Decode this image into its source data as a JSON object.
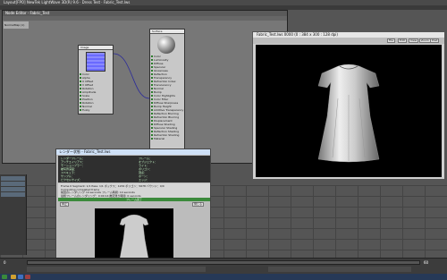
{
  "app": {
    "title": "Layout[FPO] NewTek LightWave 3D(R) 9.6 · Dress Test · Fabric_Test.lws"
  },
  "node_editor": {
    "title": "Node Editor - Fabric_Test",
    "side_label": "NormalMap (1)",
    "image_node": {
      "title": "Image",
      "ports": [
        "Color",
        "Alpha",
        "U Offset",
        "V Offset",
        "Rotation",
        "Amplitude",
        "Scale",
        "Position",
        "Rotation",
        "Normal",
        "Fuzzy"
      ]
    },
    "surface_node": {
      "title": "Surface",
      "ports": [
        "Color",
        "Luminosity",
        "Diffuse",
        "Specular",
        "Glossiness",
        "Reflection",
        "Transparency",
        "Refraction Index",
        "Translucency",
        "Normal",
        "Bump",
        "Color Highlights",
        "Color Filter",
        "Diffuse Sharpness",
        "Bump Height",
        "Additive Transparency",
        "Reflection Blurring",
        "Refraction Blurring",
        "Displacement",
        "Diffuse Shading",
        "Specular Shading",
        "Reflection Shading",
        "Refraction Shading",
        "Material"
      ]
    }
  },
  "render_window": {
    "title": "Fabric_Test.lws  0000  (0  :  384  x  300  :  128  dpi)",
    "toolbar": [
      "File",
      "Edit",
      "View",
      "Zoom",
      "Post"
    ]
  },
  "status_window": {
    "title": "レンダー状態 - Fabric_Test.lws",
    "info_left": [
      "レンダーフレーム：",
      "アンチエイリアス：",
      "モーションブラー：",
      "被写界深度：",
      "スペキュラ：",
      "サンプル：",
      "ピクセルサイズ："
    ],
    "info_right": [
      "フレーム：",
      "オブジェクト：",
      "ライト：",
      "ポリゴン：",
      "頂点：",
      "ボーン：",
      "エッジ："
    ],
    "progress_lines": [
      "Frame 0     Segment: 1/1     Pass: 1/1     ボックス：1234     ポリゴン：5678     バウンド：0/0",
      "Computing completed frame",
      "前回のレンダリング 14 seconds        フレーム時間: 14 seconds",
      "最終フレームのレンダリング：0:00:14        推定残り時間: 0 seconds"
    ],
    "progress_label": "フレーム完了",
    "buttons": [
      "中止",
      "閉じる"
    ]
  },
  "timeline": {
    "frame": "0",
    "end": "60"
  }
}
